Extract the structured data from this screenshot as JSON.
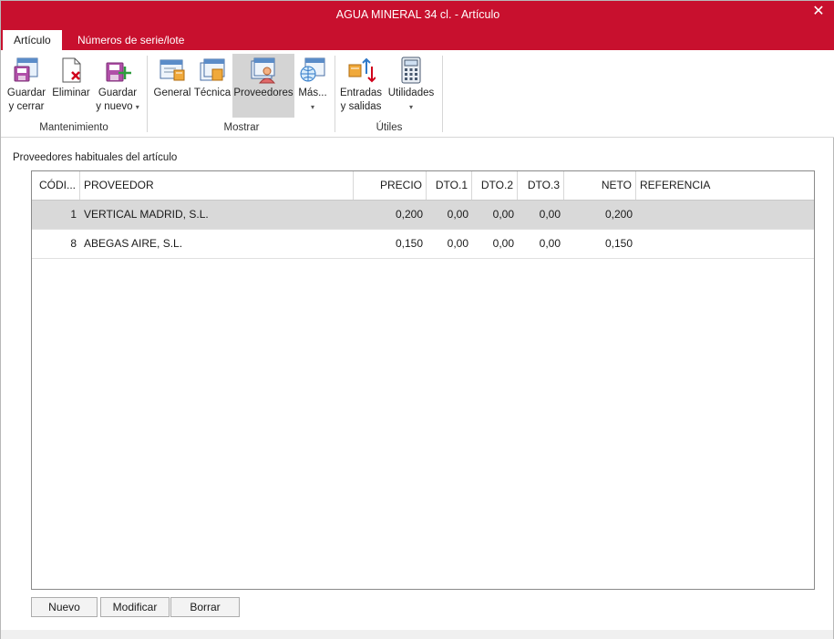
{
  "window": {
    "title": "AGUA MINERAL 34 cl. - Artículo",
    "close_glyph": "✕"
  },
  "tabs": [
    {
      "label": "Artículo",
      "active": true
    },
    {
      "label": "Números de serie/lote",
      "active": false
    }
  ],
  "ribbon": {
    "groups": [
      {
        "label": "Mantenimiento"
      },
      {
        "label": "Mostrar"
      },
      {
        "label": "Útiles"
      }
    ],
    "buttons": {
      "guardar_cerrar": {
        "line1": "Guardar",
        "line2": "y cerrar",
        "icon": "save-close-icon"
      },
      "eliminar": {
        "line1": "Eliminar",
        "icon": "delete-doc-icon"
      },
      "guardar_nuevo": {
        "line1": "Guardar",
        "line2": "y nuevo",
        "caret": "▾",
        "icon": "save-new-icon"
      },
      "general": {
        "line1": "General",
        "icon": "general-icon"
      },
      "tecnica": {
        "line1": "Técnica",
        "icon": "technical-icon"
      },
      "proveedores": {
        "line1": "Proveedores",
        "icon": "suppliers-icon",
        "selected": true
      },
      "mas": {
        "line1": "Más...",
        "caret": "▾",
        "icon": "more-globe-icon"
      },
      "entradas_salidas": {
        "line1": "Entradas",
        "line2": "y salidas",
        "icon": "in-out-icon"
      },
      "utilidades": {
        "line1": "Utilidades",
        "caret": "▾",
        "icon": "calculator-icon"
      }
    }
  },
  "section": {
    "title": "Proveedores habituales del artículo"
  },
  "table": {
    "columns": [
      "CÓDI...",
      "PROVEEDOR",
      "PRECIO",
      "DTO.1",
      "DTO.2",
      "DTO.3",
      "NETO",
      "REFERENCIA"
    ],
    "rows": [
      {
        "codigo": "1",
        "proveedor": "VERTICAL MADRID, S.L.",
        "precio": "0,200",
        "dto1": "0,00",
        "dto2": "0,00",
        "dto3": "0,00",
        "neto": "0,200",
        "referencia": "",
        "selected": true
      },
      {
        "codigo": "8",
        "proveedor": "ABEGAS AIRE, S.L.",
        "precio": "0,150",
        "dto1": "0,00",
        "dto2": "0,00",
        "dto3": "0,00",
        "neto": "0,150",
        "referencia": "",
        "selected": false
      }
    ]
  },
  "actions": {
    "nuevo": "Nuevo",
    "modificar": "Modificar",
    "borrar": "Borrar"
  },
  "colors": {
    "accent": "#c8102e",
    "selected_row": "#d9d9d9",
    "selected_button": "#d4d4d4"
  }
}
